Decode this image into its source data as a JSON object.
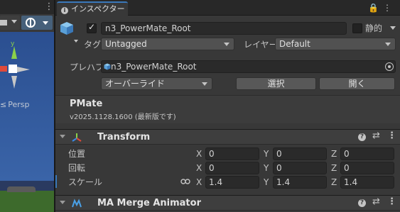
{
  "scene": {
    "menu_glyph": "⋮",
    "gizmo_y_label": "y",
    "persp_glyph": "≤",
    "persp_label": "Persp"
  },
  "inspector": {
    "tab_label": "インスペクター",
    "tab_icons": "🔒⋮",
    "object": {
      "active": true,
      "name": "n3_PowerMate_Root",
      "static_label": "静的",
      "tag_label": "タグ",
      "tag_value": "Untagged",
      "layer_label": "レイヤー",
      "layer_value": "Default"
    },
    "prefab": {
      "label": "プレハブ",
      "asset_name": "n3_PowerMate_Root",
      "overrides_label": "オーバーライド",
      "select_label": "選択",
      "open_label": "開く"
    },
    "pmate": {
      "title": "PMate",
      "version": "v2025.1128.1600 (最新版です)"
    },
    "transform": {
      "title": "Transform",
      "rows": [
        {
          "label": "位置",
          "x": "0",
          "y": "0",
          "z": "0"
        },
        {
          "label": "回転",
          "x": "0",
          "y": "0",
          "z": "0"
        },
        {
          "label": "スケール",
          "x": "1.4",
          "y": "1.4",
          "z": "1.4"
        }
      ],
      "axis_x": "X",
      "axis_y": "Y",
      "axis_z": "Z"
    },
    "merge_animator": {
      "title": "MA Merge Animator"
    },
    "header_icons": {
      "help": "?",
      "preset": "⇄",
      "more": "⋮"
    }
  },
  "colors": {
    "accent": "#3a79bb",
    "panel_bg": "#383838",
    "field_bg": "#2a2a2a"
  }
}
